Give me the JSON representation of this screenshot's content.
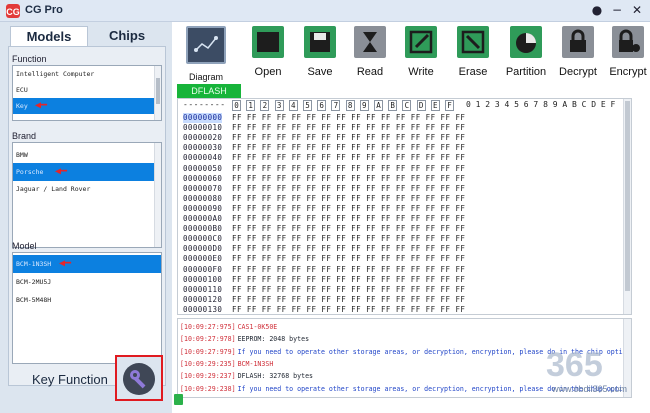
{
  "window": {
    "title": "CG Pro"
  },
  "left_tabs": [
    "Models",
    "Chips"
  ],
  "function": {
    "label": "Function",
    "items": [
      "Intelligent Computer",
      "ECU",
      "Key"
    ],
    "selected": 2
  },
  "brand": {
    "label": "Brand",
    "items": [
      "BMW",
      "Porsche",
      "Jaguar / Land Rover"
    ],
    "selected": 1
  },
  "model": {
    "label": "Model",
    "items": [
      "BCM-1N3SH",
      "BCM-2MU5J",
      "BCM-5M48H"
    ],
    "selected": 0
  },
  "key_function": {
    "label": "Key Function"
  },
  "toolbar": {
    "diagram": "Diagram",
    "open": "Open",
    "save": "Save",
    "read": "Read",
    "write": "Write",
    "erase": "Erase",
    "partition": "Partition",
    "decrypt": "Decrypt",
    "encrypt": "Encrypt"
  },
  "editor": {
    "tab": "DFLASH",
    "address_header": "--------",
    "byte_columns": [
      "0",
      "1",
      "2",
      "3",
      "4",
      "5",
      "6",
      "7",
      "8",
      "9",
      "A",
      "B",
      "C",
      "D",
      "E",
      "F"
    ],
    "ascii_header": "0 1 2 3 4 5 6 7 8 9 A B C D E F",
    "byte_fill": "FF",
    "addresses": [
      "00000000",
      "00000010",
      "00000020",
      "00000030",
      "00000040",
      "00000050",
      "00000060",
      "00000070",
      "00000080",
      "00000090",
      "000000A0",
      "000000B0",
      "000000C0",
      "000000D0",
      "000000E0",
      "000000F0",
      "00000100",
      "00000110",
      "00000120",
      "00000130"
    ]
  },
  "log": [
    {
      "time": "[10:09:27:975]",
      "text": "CAS1-0K50E",
      "color": "red"
    },
    {
      "time": "[10:09:27:978]",
      "text": "EEPROM:  2048  bytes",
      "color": "dark"
    },
    {
      "time": "[10:09:27:979]",
      "text": "If  you  need  to  operate  other  storage  areas,  or  decryption,  encryption,  please  do  in  the  chip  options!",
      "color": "blue"
    },
    {
      "time": "[10:09:29:235]",
      "text": "BCM-1N3SH",
      "color": "red"
    },
    {
      "time": "[10:09:29:237]",
      "text": "DFLASH:  32768  bytes",
      "color": "dark"
    },
    {
      "time": "[10:09:29:238]",
      "text": "If  you  need  to  operate  other  storage  areas,  or  decryption,  encryption,  please  do  in  the  chip  options!",
      "color": "blue"
    }
  ],
  "watermark": {
    "text": "www.obdii365.com"
  },
  "colors": {
    "selection": "#0c80e0",
    "dflash_tab": "#17b43a",
    "highlight_box": "#e01a20",
    "log_red": "#d0303a",
    "log_blue": "#2145c8"
  }
}
